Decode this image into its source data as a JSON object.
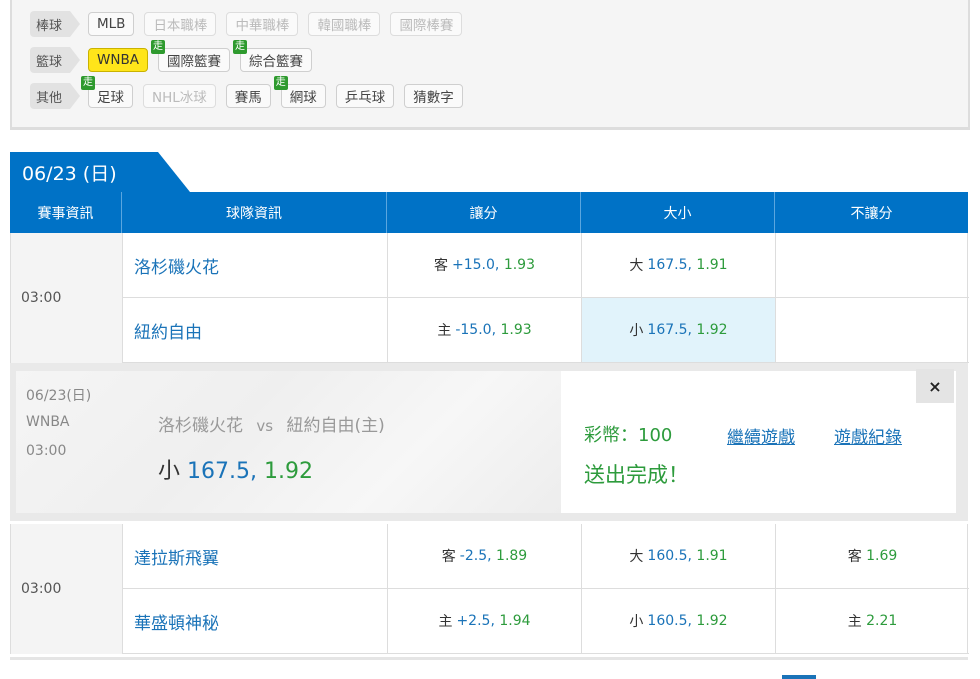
{
  "categories": [
    {
      "label": "棒球",
      "chips": [
        {
          "text": "MLB",
          "state": "normal",
          "walk": ""
        },
        {
          "text": "日本職棒",
          "state": "dim",
          "walk": ""
        },
        {
          "text": "中華職棒",
          "state": "dim",
          "walk": ""
        },
        {
          "text": "韓國職棒",
          "state": "dim",
          "walk": ""
        },
        {
          "text": "國際棒賽",
          "state": "dim",
          "walk": ""
        }
      ]
    },
    {
      "label": "籃球",
      "chips": [
        {
          "text": "WNBA",
          "state": "active",
          "walk": ""
        },
        {
          "text": "國際籃賽",
          "state": "normal",
          "walk": "走"
        },
        {
          "text": "綜合籃賽",
          "state": "normal",
          "walk": "走"
        }
      ]
    },
    {
      "label": "其他",
      "chips": [
        {
          "text": "足球",
          "state": "normal",
          "walk": "走"
        },
        {
          "text": "NHL冰球",
          "state": "dim",
          "walk": ""
        },
        {
          "text": "賽馬",
          "state": "normal",
          "walk": ""
        },
        {
          "text": "網球",
          "state": "normal",
          "walk": "走"
        },
        {
          "text": "乒乓球",
          "state": "normal",
          "walk": ""
        },
        {
          "text": "猜數字",
          "state": "normal",
          "walk": ""
        }
      ]
    }
  ],
  "date_tab": "06/23 (日)",
  "table_headers": [
    "賽事資訊",
    "球隊資訊",
    "讓分",
    "大小",
    "不讓分"
  ],
  "games": [
    {
      "time": "03:00",
      "rows": [
        {
          "team": "洛杉磯火花",
          "spread": {
            "side": "客",
            "line": "+15.0,",
            "price": "1.93"
          },
          "total": {
            "side": "大",
            "line": "167.5,",
            "price": "1.91"
          },
          "moneyline": {
            "side": "",
            "price": ""
          }
        },
        {
          "team": "紐約自由",
          "spread": {
            "side": "主",
            "line": "-15.0,",
            "price": "1.93"
          },
          "total": {
            "side": "小",
            "line": "167.5,",
            "price": "1.92"
          },
          "moneyline": {
            "side": "",
            "price": ""
          }
        }
      ]
    },
    {
      "time": "03:00",
      "rows": [
        {
          "team": "達拉斯飛翼",
          "spread": {
            "side": "客",
            "line": "-2.5,",
            "price": "1.89"
          },
          "total": {
            "side": "大",
            "line": "160.5,",
            "price": "1.91"
          },
          "moneyline": {
            "side": "客",
            "price": "1.69"
          }
        },
        {
          "team": "華盛頓神秘",
          "spread": {
            "side": "主",
            "line": "+2.5,",
            "price": "1.94"
          },
          "total": {
            "side": "小",
            "line": "160.5,",
            "price": "1.92"
          },
          "moneyline": {
            "side": "主",
            "price": "2.21"
          }
        }
      ]
    }
  ],
  "bet_slip": {
    "date": "06/23(日)",
    "league": "WNBA",
    "time": "03:00",
    "away": "洛杉磯火花",
    "vs": "vs",
    "home": "紐約自由(主)",
    "pick_side": "小",
    "pick_line": "167.5,",
    "pick_price": "1.92",
    "stake": "彩幣：100",
    "status": "送出完成！",
    "continue_link": "繼續遊戲",
    "history_link": "遊戲紀錄",
    "close": "×"
  },
  "colors": {
    "primary": "#0072c6",
    "green": "#2d9b3c",
    "link": "#1a73b8",
    "active_chip": "#ffe51a"
  }
}
